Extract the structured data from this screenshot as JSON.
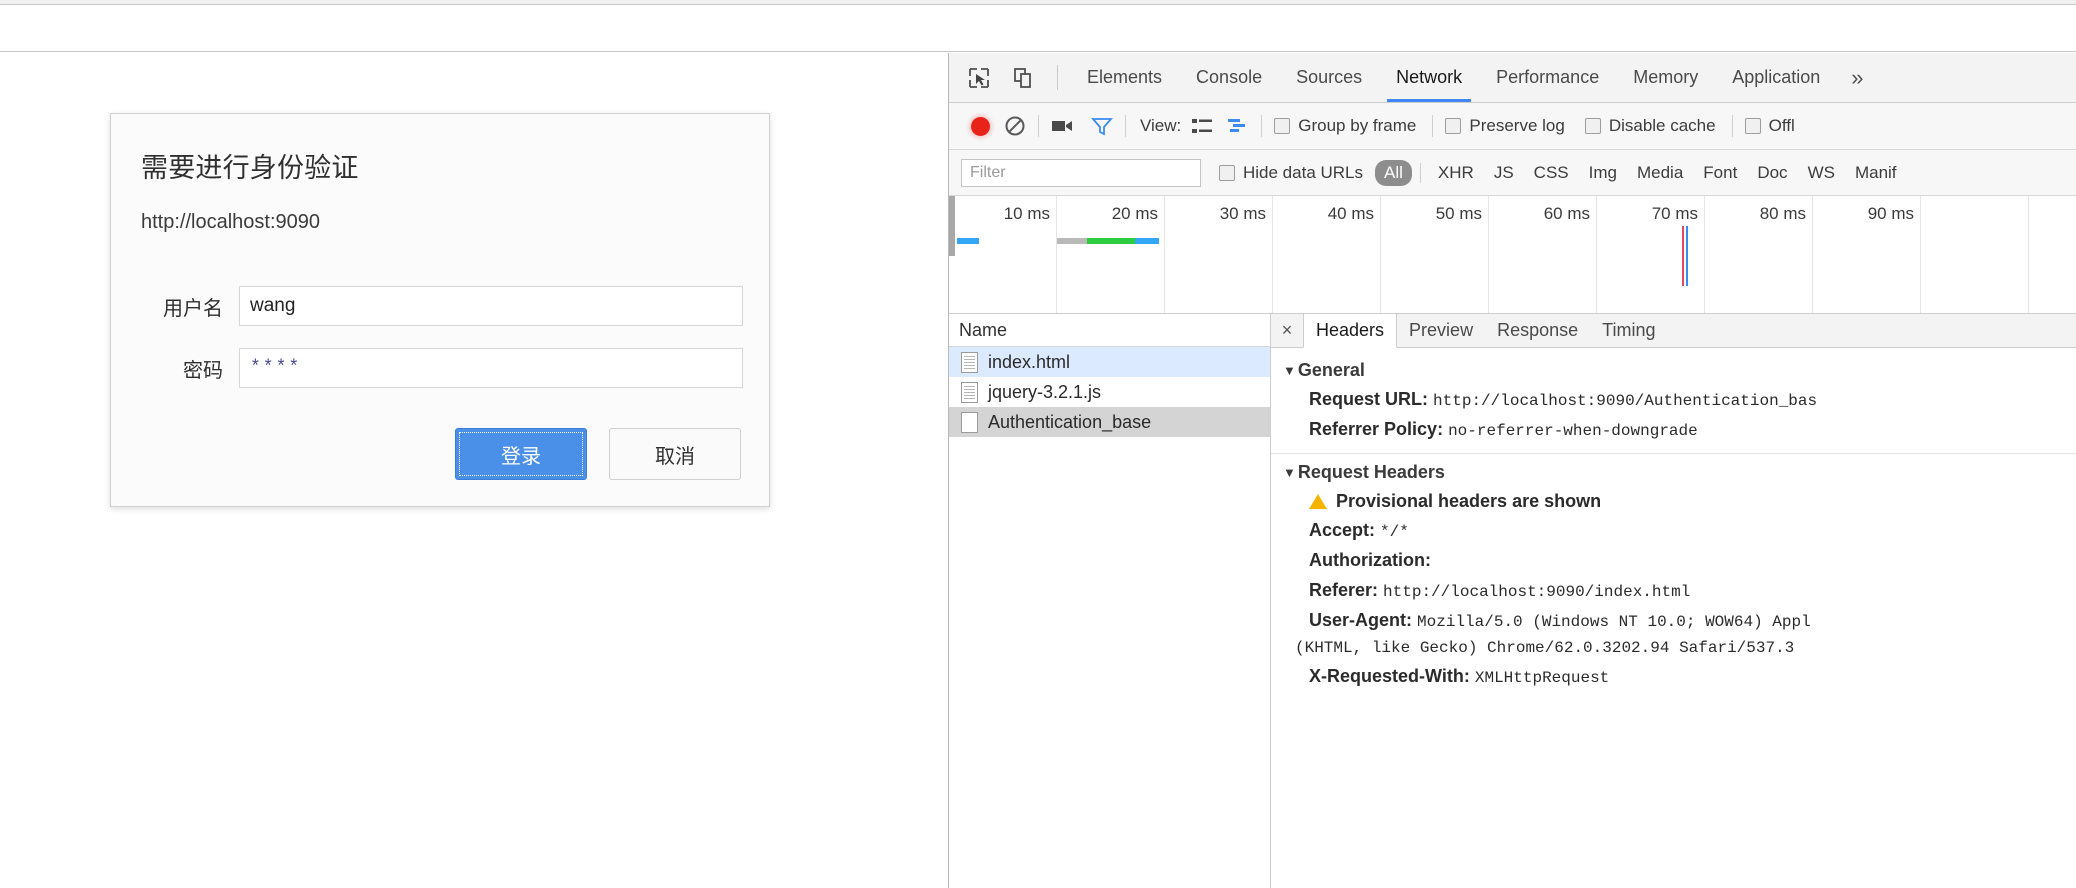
{
  "dialog": {
    "title": "需要进行身份验证",
    "origin": "http://localhost:9090",
    "username_label": "用户名",
    "username_value": "wang",
    "password_label": "密码",
    "password_value": "****",
    "login_label": "登录",
    "cancel_label": "取消"
  },
  "devtools": {
    "tabs": [
      {
        "label": "Elements",
        "active": false
      },
      {
        "label": "Console",
        "active": false
      },
      {
        "label": "Sources",
        "active": false
      },
      {
        "label": "Network",
        "active": true
      },
      {
        "label": "Performance",
        "active": false
      },
      {
        "label": "Memory",
        "active": false
      },
      {
        "label": "Application",
        "active": false
      }
    ],
    "more_tabs_glyph": "»",
    "icons": {
      "inspect": "inspect-element-icon",
      "device": "device-toolbar-icon",
      "record": "record-icon",
      "clear": "clear-icon",
      "capture_screenshots": "camera-icon",
      "filter": "funnel-icon"
    },
    "toolbar": {
      "view_label": "View:",
      "checkboxes": [
        {
          "label": "Group by frame",
          "checked": false
        },
        {
          "label": "Preserve log",
          "checked": false
        },
        {
          "label": "Disable cache",
          "checked": false
        },
        {
          "label": "Offl",
          "checked": false
        }
      ]
    },
    "filterbar": {
      "filter_placeholder": "Filter",
      "filter_value": "",
      "hide_data_urls_label": "Hide data URLs",
      "hide_data_urls_checked": false,
      "types": [
        {
          "label": "All",
          "selected": true
        },
        {
          "label": "XHR",
          "selected": false
        },
        {
          "label": "JS",
          "selected": false
        },
        {
          "label": "CSS",
          "selected": false
        },
        {
          "label": "Img",
          "selected": false
        },
        {
          "label": "Media",
          "selected": false
        },
        {
          "label": "Font",
          "selected": false
        },
        {
          "label": "Doc",
          "selected": false
        },
        {
          "label": "WS",
          "selected": false
        },
        {
          "label": "Manif",
          "selected": false
        }
      ]
    },
    "timeline": {
      "ticks": [
        "10 ms",
        "20 ms",
        "30 ms",
        "40 ms",
        "50 ms",
        "60 ms",
        "70 ms",
        "80 ms",
        "90 ms"
      ]
    },
    "request_list": {
      "column_header": "Name",
      "rows": [
        {
          "name": "index.html",
          "state": "highlight",
          "icon": "document-icon"
        },
        {
          "name": "jquery-3.2.1.js",
          "state": "normal",
          "icon": "document-icon"
        },
        {
          "name": "Authentication_base",
          "state": "selected",
          "icon": "blank-document-icon"
        }
      ]
    },
    "detail": {
      "close_glyph": "×",
      "tabs": [
        {
          "label": "Headers",
          "active": true
        },
        {
          "label": "Preview",
          "active": false
        },
        {
          "label": "Response",
          "active": false
        },
        {
          "label": "Timing",
          "active": false
        }
      ],
      "general_title": "General",
      "general_rows": [
        {
          "name": "Request URL:",
          "value": "http://localhost:9090/Authentication_bas"
        },
        {
          "name": "Referrer Policy:",
          "value": "no-referrer-when-downgrade"
        }
      ],
      "request_headers_title": "Request Headers",
      "provisional_warning": "Provisional headers are shown",
      "request_header_rows": [
        {
          "name": "Accept:",
          "value": "*/*"
        },
        {
          "name": "Authorization:",
          "value": ""
        },
        {
          "name": "Referer:",
          "value": "http://localhost:9090/index.html"
        },
        {
          "name": "User-Agent:",
          "value": "Mozilla/5.0 (Windows NT 10.0; WOW64) Appl"
        }
      ],
      "user_agent_wrap": "(KHTML, like Gecko) Chrome/62.0.3202.94 Safari/537.3",
      "last_header": {
        "name": "X-Requested-With:",
        "value": "XMLHttpRequest"
      }
    },
    "colors": {
      "accent": "#4285f4",
      "record": "#e8241a",
      "warning": "#f5b400",
      "selected_row": "#d4d4d4",
      "highlight_row": "#dbeaff",
      "login_button": "#4a90e8"
    }
  }
}
